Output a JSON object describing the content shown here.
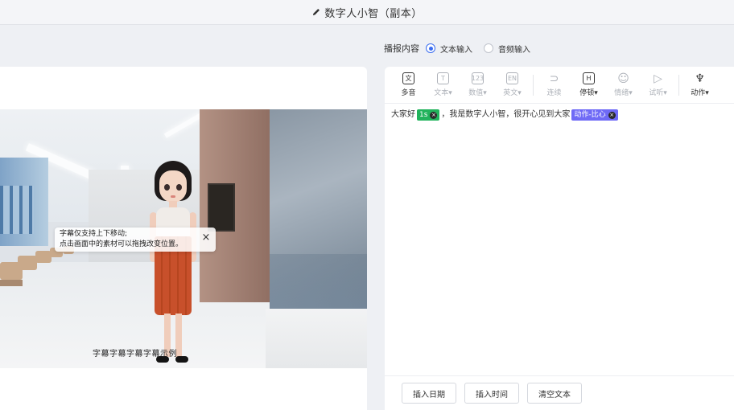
{
  "header": {
    "title": "数字人小智（副本）",
    "edit_icon": "pencil-icon"
  },
  "content_type": {
    "label": "播报内容",
    "options": [
      {
        "label": "文本输入",
        "selected": true
      },
      {
        "label": "音频输入",
        "selected": false
      }
    ],
    "accent": "#3a6df0"
  },
  "preview": {
    "tooltip": {
      "line1": "字幕仅支持上下移动;",
      "line2": "点击画面中的素材可以拖拽改变位置。"
    },
    "caption": "字幕字幕字幕字幕示例"
  },
  "toolbar": {
    "tools": [
      {
        "icon": "文",
        "label": "多音",
        "enabled": true
      },
      {
        "icon": "T",
        "label": "文本▾",
        "enabled": false
      },
      {
        "icon": "123",
        "label": "数值▾",
        "enabled": false
      },
      {
        "icon": "EN",
        "label": "英文▾",
        "enabled": false
      },
      {
        "icon": "⊃",
        "label": "连续",
        "enabled": false
      },
      {
        "icon": "H",
        "label": "停顿▾",
        "enabled": true
      },
      {
        "icon": "☺",
        "label": "情绪▾",
        "enabled": false
      },
      {
        "icon": "▷",
        "label": "试听▾",
        "enabled": false
      },
      {
        "icon": "♆",
        "label": "动作▾",
        "enabled": true
      }
    ]
  },
  "editor": {
    "text_before": "大家好",
    "pause_tag": "1s",
    "text_after": "，我是数字人小智，很开心见到大家",
    "action_tag": "动作-比心",
    "pause_color": "#22b35c",
    "action_color": "#6f6af6"
  },
  "footer": {
    "insert_date": "插入日期",
    "insert_time": "插入时间",
    "clear_text": "清空文本"
  }
}
